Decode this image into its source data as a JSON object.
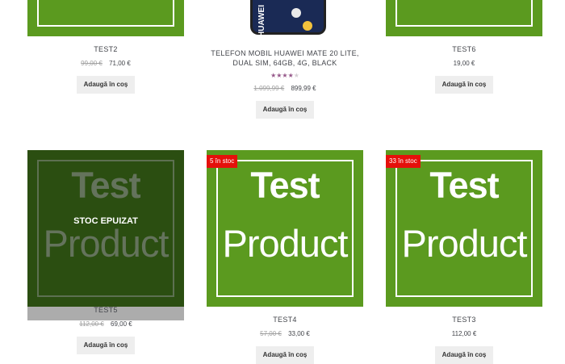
{
  "products": [
    {
      "name": "TEST2",
      "old_price": "99,00 €",
      "price": "71,00 €",
      "button": "Adaugă în coș"
    },
    {
      "name": "TELEFON MOBIL HUAWEI MATE 20 LITE, DUAL SIM, 64GB, 4G, BLACK",
      "old_price": "1.099,99 €",
      "price": "899,99 €",
      "button": "Adaugă în coș",
      "rating": 3.5,
      "rating_max": 5,
      "image_brand_text": "HUAWEI"
    },
    {
      "name": "TEST6",
      "price": "19,00 €",
      "button": "Adaugă în coș"
    },
    {
      "name": "TEST5",
      "old_price": "112,00 €",
      "price": "69,00 €",
      "out_of_stock": "STOC EPUIZAT",
      "button": "Adaugă în coș"
    },
    {
      "name": "TEST4",
      "old_price": "57,00 €",
      "price": "33,00 €",
      "badge": "5 în stoc",
      "button": "Adaugă în coș"
    },
    {
      "name": "TEST3",
      "price": "112,00 €",
      "badge": "33 în stoc",
      "button": "Adaugă în coș"
    }
  ],
  "placeholder_image": {
    "line1": "Test",
    "line2": "Product",
    "bg_color": "#5b9a1f"
  },
  "colors": {
    "badge": "#e5100b",
    "rating": "#96588a",
    "button_bg": "#eeeeee"
  }
}
